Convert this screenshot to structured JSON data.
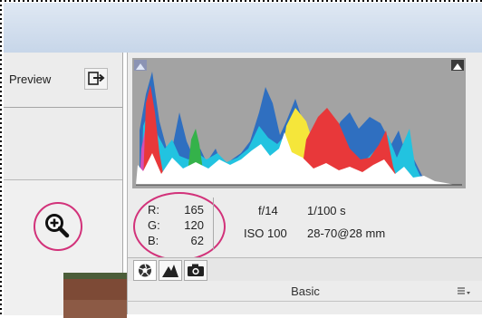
{
  "preview": {
    "label": "Preview"
  },
  "readout": {
    "r_label": "R:",
    "r_value": "165",
    "g_label": "G:",
    "g_value": "120",
    "b_label": "B:",
    "b_value": "62"
  },
  "exif": {
    "aperture": "f/14",
    "shutter": "1/100 s",
    "iso": "ISO 100",
    "lens": "28-70@28 mm"
  },
  "panel": {
    "section_title": "Basic"
  },
  "colors": {
    "highlight_circle": "#d2327a",
    "histogram_bg": "#a3a3a3",
    "red": "#e8383a",
    "yellow": "#f5e63a",
    "cyan": "#22c3e0",
    "blue": "#2f6fc0",
    "green": "#34b24a",
    "magenta": "#d54fb7"
  },
  "icons": {
    "swap": "swap-arrows-icon",
    "zoom": "zoom-in-icon",
    "shadow_clip": "shadow-clipping-warning-icon",
    "highlight_clip": "highlight-clipping-warning-icon",
    "tab_basic": "aperture-icon",
    "tab_tone_curve": "tone-curve-icon",
    "tab_camera": "camera-icon",
    "section_menu": "panel-menu-icon"
  }
}
